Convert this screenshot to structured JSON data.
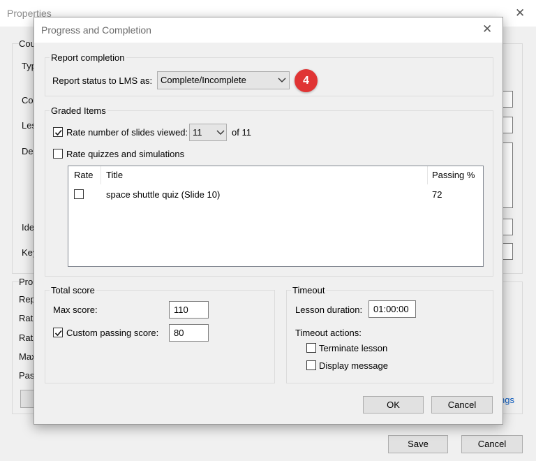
{
  "background_window": {
    "title": "Properties",
    "partial_labels": [
      "Cou",
      "Typ",
      "Cou",
      "Les",
      "Des",
      "Ide",
      "Key",
      "Pro",
      "Rep",
      "Rat",
      "Rat",
      "Max",
      "Pas"
    ],
    "link_fragment": "ngs",
    "save_label": "Save",
    "cancel_label": "Cancel"
  },
  "dialog": {
    "title": "Progress and Completion",
    "report_completion": {
      "group_title": "Report completion",
      "status_label": "Report status to LMS as:",
      "status_value": "Complete/Incomplete",
      "badge": "4"
    },
    "graded_items": {
      "group_title": "Graded Items",
      "rate_slides": {
        "label": "Rate number of slides viewed:",
        "checked": true,
        "value": "11",
        "suffix": "of 11"
      },
      "rate_quizzes": {
        "label": "Rate quizzes and simulations",
        "checked": false
      },
      "table": {
        "columns": [
          "Rate",
          "Title",
          "Passing %"
        ],
        "rows": [
          {
            "rate_checked": false,
            "title": "space shuttle quiz (Slide 10)",
            "passing": "72"
          }
        ]
      }
    },
    "total_score": {
      "group_title": "Total score",
      "max_score_label": "Max score:",
      "max_score_value": "110",
      "custom_passing_label": "Custom passing score:",
      "custom_passing_checked": true,
      "custom_passing_value": "80"
    },
    "timeout": {
      "group_title": "Timeout",
      "lesson_duration_label": "Lesson duration:",
      "lesson_duration_value": "01:00:00",
      "actions_label": "Timeout actions:",
      "terminate_label": "Terminate lesson",
      "terminate_checked": false,
      "display_message_label": "Display message",
      "display_message_checked": false
    },
    "ok_label": "OK",
    "cancel_label": "Cancel"
  },
  "colors": {
    "badge": "#e03434",
    "link": "#0b5bbf",
    "window_bg": "#f0f0f0"
  }
}
